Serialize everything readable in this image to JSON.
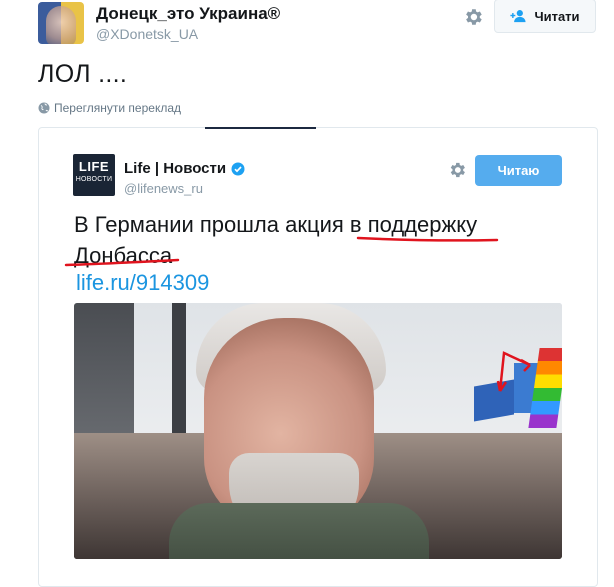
{
  "outer_tweet": {
    "author_name": "Донецк_это Украина®",
    "author_handle": "@XDonetsk_UA",
    "follow_label": "Читати",
    "text": "ЛОЛ ....",
    "translate_label": "Переглянути переклад"
  },
  "quoted_tweet": {
    "logo_line1": "LIFE",
    "logo_line2": "НОВОСТИ",
    "author_name": "Life | Новости",
    "author_handle": "@lifenews_ru",
    "follow_label": "Читаю",
    "text": "В Германии прошла акция в поддержку Донбасса",
    "link": "life.ru/914309"
  },
  "colors": {
    "follow_blue": "#55acee",
    "link_blue": "#1b95e0",
    "annotation_red": "#e0141e"
  }
}
